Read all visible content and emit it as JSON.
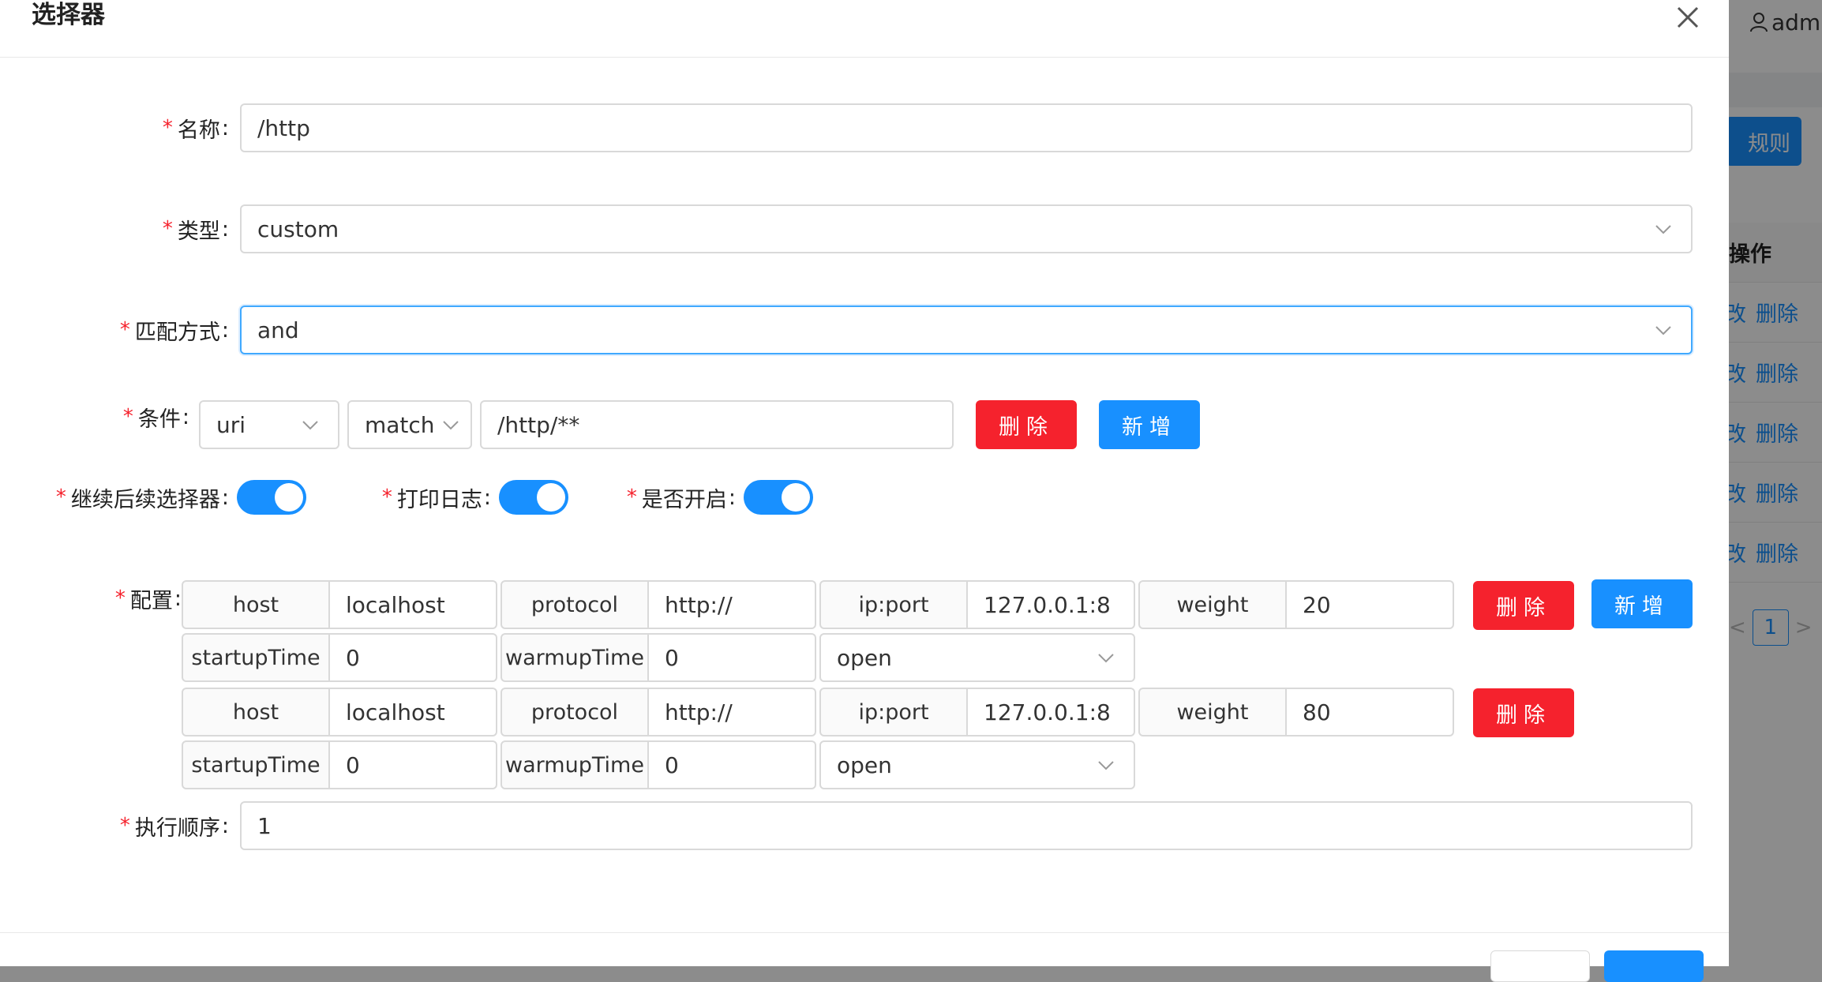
{
  "modal": {
    "title": "选择器",
    "close_icon": "close-icon"
  },
  "background": {
    "user_icon": "user-icon",
    "user_name": "admi",
    "add_rule_label": "规则",
    "column_header": "操作",
    "rows": [
      {
        "edit": "改",
        "delete": "删除"
      },
      {
        "edit": "改",
        "delete": "删除"
      },
      {
        "edit": "改",
        "delete": "删除"
      },
      {
        "edit": "改",
        "delete": "删除"
      },
      {
        "edit": "改",
        "delete": "删除"
      }
    ],
    "pager": {
      "prev": "<",
      "page": "1",
      "next": ">"
    }
  },
  "form": {
    "required_mark": "*",
    "colon": ":",
    "name": {
      "label": "名称",
      "value": "/http"
    },
    "type": {
      "label": "类型",
      "value": "custom"
    },
    "match_mode": {
      "label": "匹配方式",
      "value": "and"
    },
    "condition": {
      "label": "条件",
      "param_type": "uri",
      "operator": "match",
      "value": "/http/**",
      "delete_label": "删除",
      "add_label": "新增"
    },
    "continued": {
      "label": "继续后续选择器",
      "on": true
    },
    "logged": {
      "label": "打印日志",
      "on": true
    },
    "enabled": {
      "label": "是否开启",
      "on": true
    },
    "config": {
      "label": "配置",
      "delete_label": "删除",
      "add_label": "新增",
      "upstreams": [
        {
          "host_label": "host",
          "host": "localhost",
          "protocol_label": "protocol",
          "protocol": "http://",
          "ipport_label": "ip:port",
          "ipport": "127.0.0.1:8",
          "weight_label": "weight",
          "weight": "20",
          "startup_label": "startupTime",
          "startup": "0",
          "warmup_label": "warmupTime",
          "warmup": "0",
          "status": "open"
        },
        {
          "host_label": "host",
          "host": "localhost",
          "protocol_label": "protocol",
          "protocol": "http://",
          "ipport_label": "ip:port",
          "ipport": "127.0.0.1:8",
          "weight_label": "weight",
          "weight": "80",
          "startup_label": "startupTime",
          "startup": "0",
          "warmup_label": "warmupTime",
          "warmup": "0",
          "status": "open"
        }
      ]
    },
    "sort": {
      "label": "执行顺序",
      "value": "1"
    }
  },
  "colors": {
    "primary": "#1890ff",
    "danger": "#f5222d",
    "required": "#f5222d",
    "border": "#d9d9d9",
    "addon_bg": "#fafafa"
  }
}
